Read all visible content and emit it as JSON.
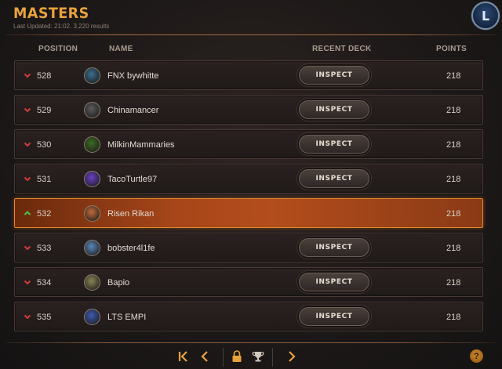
{
  "header": {
    "title": "MASTERS",
    "subtitle": "Last Updated: 21:02. 3,220 results",
    "badge_icon": "legends-of-runeterra-icon"
  },
  "columns": {
    "position": "POSITION",
    "name": "NAME",
    "recent_deck": "RECENT DECK",
    "points": "POINTS"
  },
  "rows": [
    {
      "position": "528",
      "name": "FNX bywhitte",
      "points": "218",
      "trend": "down",
      "inspect": "INSPECT",
      "avatar_color": "#3a6e8f"
    },
    {
      "position": "529",
      "name": "Chinamancer",
      "points": "218",
      "trend": "down",
      "inspect": "INSPECT",
      "avatar_color": "#5a5a5a"
    },
    {
      "position": "530",
      "name": "MilkinMammaries",
      "points": "218",
      "trend": "down",
      "inspect": "INSPECT",
      "avatar_color": "#3d6b22"
    },
    {
      "position": "531",
      "name": "TacoTurtle97",
      "points": "218",
      "trend": "down",
      "inspect": "INSPECT",
      "avatar_color": "#6a3fc4"
    },
    {
      "position": "532",
      "name": "Risen Rikan",
      "points": "218",
      "trend": "up",
      "inspect": "",
      "avatar_color": "#c26a3a",
      "highlighted": true
    },
    {
      "position": "533",
      "name": "bobster4l1fe",
      "points": "218",
      "trend": "down",
      "inspect": "INSPECT",
      "avatar_color": "#5a86b8"
    },
    {
      "position": "534",
      "name": "Bapio",
      "points": "218",
      "trend": "down",
      "inspect": "INSPECT",
      "avatar_color": "#8a8455"
    },
    {
      "position": "535",
      "name": "LTS EMPI",
      "points": "218",
      "trend": "down",
      "inspect": "INSPECT",
      "avatar_color": "#3f5bb0"
    }
  ],
  "pager": {
    "first_icon": "first-page-icon",
    "prev_icon": "previous-page-icon",
    "lock_icon": "lock-icon",
    "trophy_icon": "trophy-icon",
    "next_icon": "next-page-icon",
    "help_label": "?"
  },
  "colors": {
    "accent": "#e8a23d",
    "trend_down": "#d23c3c",
    "trend_up": "#4fc34a",
    "highlight": "#b34d1c"
  }
}
